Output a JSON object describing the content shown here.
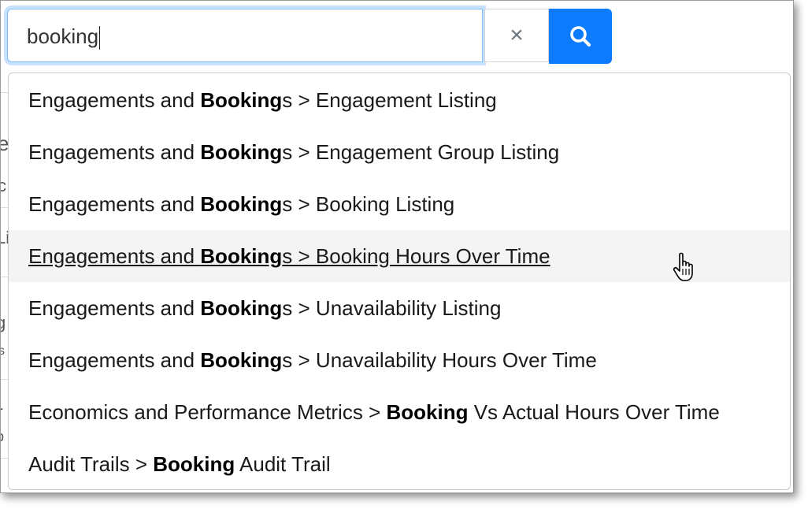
{
  "search": {
    "value": "booking",
    "clear_icon": "×",
    "search_icon": "magnifier-icon"
  },
  "suggestions": [
    {
      "pre": "Engagements and ",
      "bold": "Booking",
      "post": "s > Engagement Listing"
    },
    {
      "pre": "Engagements and ",
      "bold": "Booking",
      "post": "s > Engagement Group Listing"
    },
    {
      "pre": "Engagements and ",
      "bold": "Booking",
      "post": "s > Booking Listing"
    },
    {
      "pre": "Engagements and ",
      "bold": "Booking",
      "post": "s > Booking Hours Over Time"
    },
    {
      "pre": "Engagements and ",
      "bold": "Booking",
      "post": "s > Unavailability Listing"
    },
    {
      "pre": "Engagements and ",
      "bold": "Booking",
      "post": "s > Unavailability Hours Over Time"
    },
    {
      "pre": "Economics and Performance Metrics > ",
      "bold": "Booking",
      "post": " Vs Actual Hours Over Time"
    },
    {
      "pre": "Audit Trails > ",
      "bold": "Booking",
      "post": " Audit Trail"
    }
  ],
  "background_fragments": [
    "e",
    "c",
    "Li",
    "g",
    "s",
    "-",
    "b"
  ],
  "colors": {
    "accent": "#0d7bfe",
    "focus_border": "#80bdff",
    "hover_bg": "#f4f4f4"
  }
}
